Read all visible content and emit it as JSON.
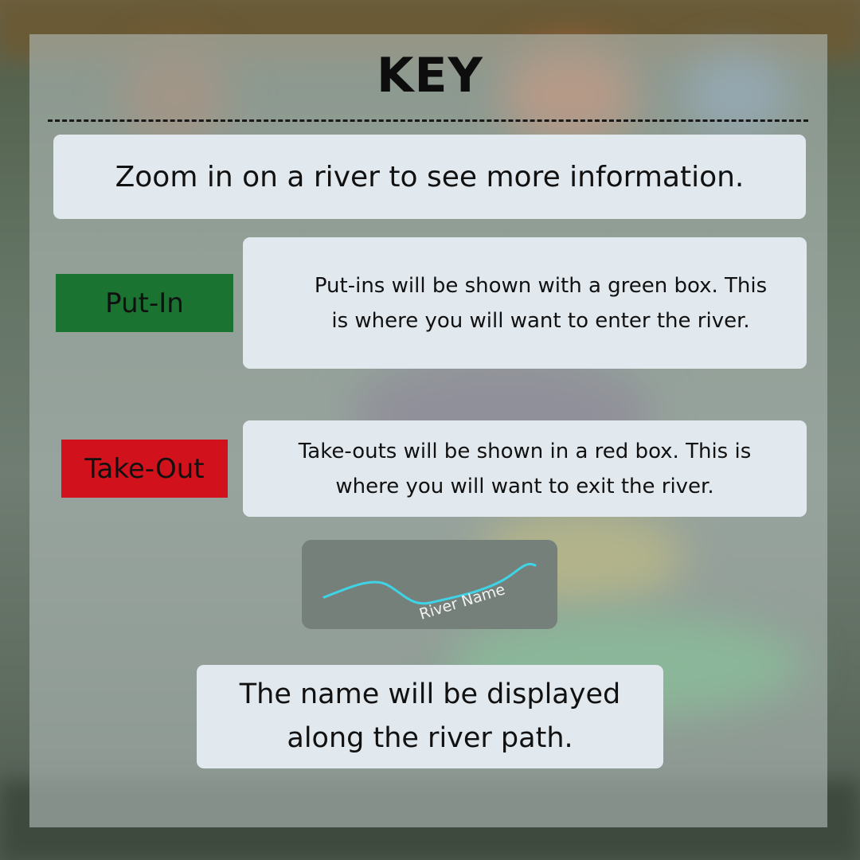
{
  "title": "KEY",
  "zoom_hint": "Zoom in on a river to see more information.",
  "put_in": {
    "label": "Put-In",
    "color": "#1b7332",
    "description": "Put-ins will be shown with a green box. This is where you will want to enter the river."
  },
  "take_out": {
    "label": "Take-Out",
    "color": "#d1111b",
    "description": "Take-outs will be shown in a red box. This is where you will want to exit the river."
  },
  "river_sample": {
    "label": "River Name",
    "line_color": "#3fd3e6"
  },
  "name_hint": "The name will be displayed along the river path."
}
